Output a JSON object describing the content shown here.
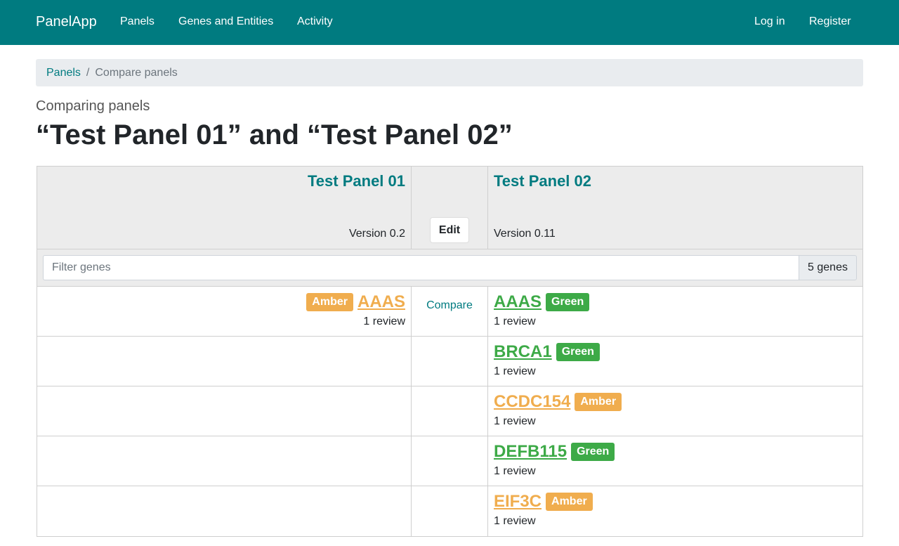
{
  "navbar": {
    "brand": "PanelApp",
    "links": [
      "Panels",
      "Genes and Entities",
      "Activity"
    ],
    "login": "Log in",
    "register": "Register"
  },
  "breadcrumb": {
    "home": "Panels",
    "separator": "/",
    "current": "Compare panels"
  },
  "subtitle": "Comparing panels",
  "title": "“Test Panel 01” and “Test Panel 02”",
  "compare": {
    "left_panel": {
      "name": "Test Panel 01",
      "version": "Version 0.2"
    },
    "right_panel": {
      "name": "Test Panel 02",
      "version": "Version 0.11"
    },
    "edit_label": "Edit",
    "filter_placeholder": "Filter genes",
    "gene_count": "5 genes",
    "compare_label": "Compare",
    "rows": [
      {
        "left": {
          "gene": "AAAS",
          "rating": "Amber",
          "reviews": "1 review"
        },
        "right": {
          "gene": "AAAS",
          "rating": "Green",
          "reviews": "1 review"
        }
      },
      {
        "right": {
          "gene": "BRCA1",
          "rating": "Green",
          "reviews": "1 review"
        }
      },
      {
        "right": {
          "gene": "CCDC154",
          "rating": "Amber",
          "reviews": "1 review"
        }
      },
      {
        "right": {
          "gene": "DEFB115",
          "rating": "Green",
          "reviews": "1 review"
        }
      },
      {
        "right": {
          "gene": "EIF3C",
          "rating": "Amber",
          "reviews": "1 review"
        }
      }
    ]
  },
  "colors": {
    "brand": "#007b80",
    "green": "#3daa47",
    "amber": "#f0ad4e"
  }
}
